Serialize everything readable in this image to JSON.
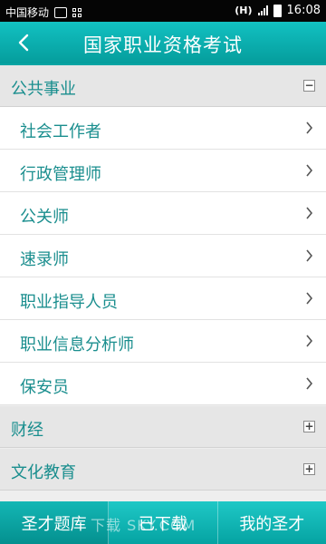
{
  "status_bar": {
    "carrier": "中国移动",
    "time": "16:08",
    "net_label": "(H)"
  },
  "header": {
    "title": "国家职业资格考试",
    "back_icon": "chevron-left-icon"
  },
  "groups": [
    {
      "label": "公共事业",
      "state_symbol": "−",
      "expanded": true,
      "items": [
        "社会工作者",
        "行政管理师",
        "公关师",
        "速录师",
        "职业指导人员",
        "职业信息分析师",
        "保安员"
      ]
    },
    {
      "label": "财经",
      "state_symbol": "+",
      "expanded": false
    },
    {
      "label": "文化教育",
      "state_symbol": "+",
      "expanded": false
    }
  ],
  "bottom_nav": {
    "tabs": [
      "圣才题库",
      "已下载",
      "我的圣才"
    ],
    "active_index": 0
  },
  "watermark": "下载 SKY.COM",
  "colors": {
    "accent": "#0aaeae",
    "text_teal": "#1a8e8e",
    "group_bg": "#e6e6e6",
    "status_bar": "#050505"
  }
}
